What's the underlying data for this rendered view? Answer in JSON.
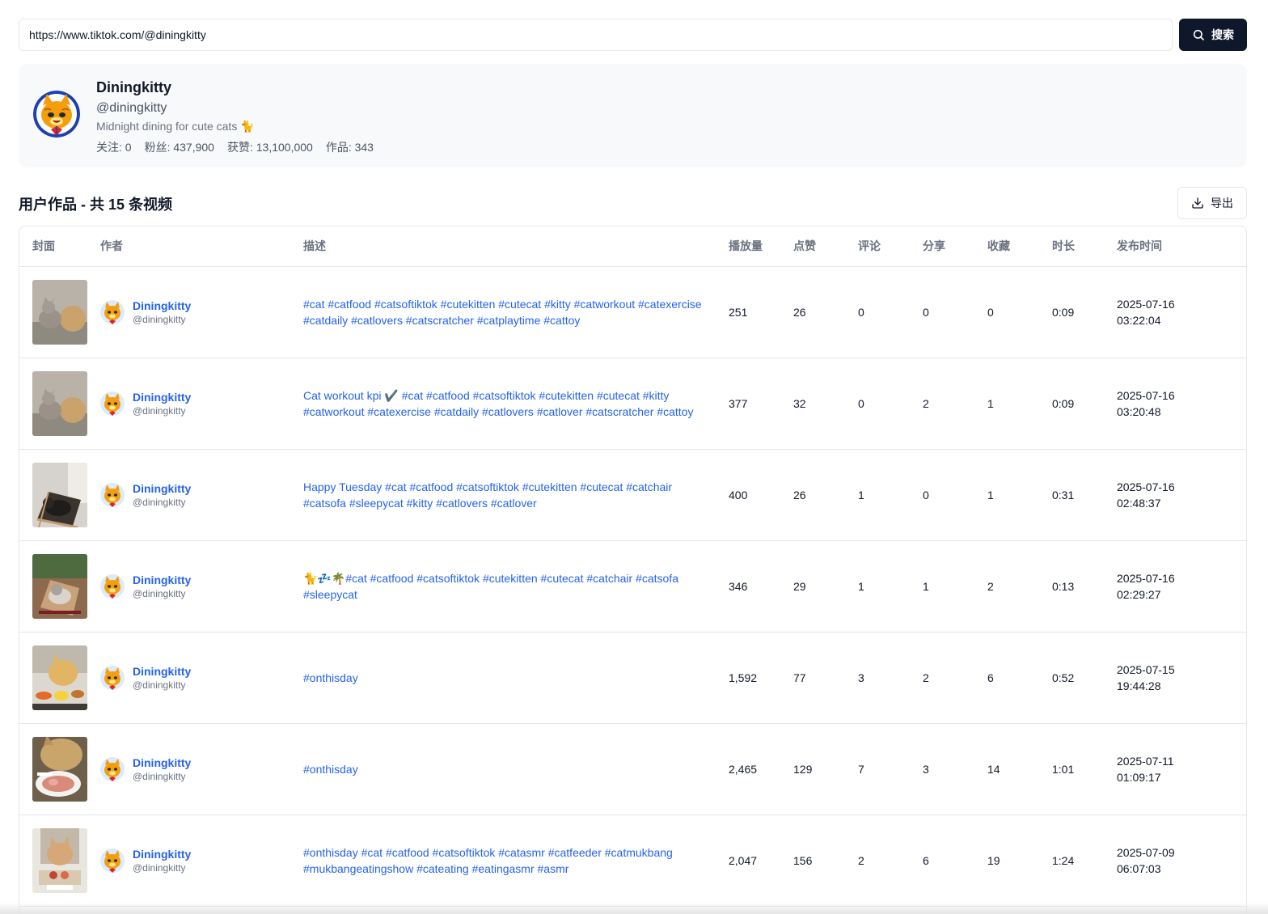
{
  "search": {
    "value": "https://www.tiktok.com/@diningkitty",
    "button_label": "搜索"
  },
  "profile": {
    "name": "Diningkitty",
    "handle": "@diningkitty",
    "bio": "Midnight dining for cute cats 🐈",
    "stats": [
      "关注: 0",
      "粉丝: 437,900",
      "获赞: 13,100,000",
      "作品: 343"
    ]
  },
  "section": {
    "title": "用户作品 - 共 15 条视频",
    "export_label": "导出"
  },
  "table": {
    "headers": {
      "cover": "封面",
      "author": "作者",
      "desc": "描述",
      "plays": "播放量",
      "likes": "点赞",
      "comments": "评论",
      "shares": "分享",
      "favorites": "收藏",
      "duration": "时长",
      "published": "发布时间"
    },
    "rows": [
      {
        "author_name": "Diningkitty",
        "author_handle": "@diningkitty",
        "desc": "#cat #catfood #catsoftiktok #cutekitten #cutecat #kitty #catworkout #catexercise #catdaily #catlovers #catscratcher #catplaytime #cattoy",
        "plays": "251",
        "likes": "26",
        "comments": "0",
        "shares": "0",
        "favorites": "0",
        "duration": "0:09",
        "date": "2025-07-16",
        "time": "03:22:04",
        "thumb": "cat-ball"
      },
      {
        "author_name": "Diningkitty",
        "author_handle": "@diningkitty",
        "desc": "Cat workout kpi ✔️ #cat #catfood #catsoftiktok #cutekitten #cutecat #kitty #catworkout #catexercise #catdaily #catlovers #catlover #catscratcher #cattoy",
        "plays": "377",
        "likes": "32",
        "comments": "0",
        "shares": "2",
        "favorites": "1",
        "duration": "0:09",
        "date": "2025-07-16",
        "time": "03:20:48",
        "thumb": "cat-ball"
      },
      {
        "author_name": "Diningkitty",
        "author_handle": "@diningkitty",
        "desc": "Happy Tuesday #cat #catfood #catsoftiktok #cutekitten #cutecat #catchair #catsofa #sleepycat #kitty #catlovers #catlover",
        "plays": "400",
        "likes": "26",
        "comments": "1",
        "shares": "0",
        "favorites": "1",
        "duration": "0:31",
        "date": "2025-07-16",
        "time": "02:48:37",
        "thumb": "cat-chair-dark"
      },
      {
        "author_name": "Diningkitty",
        "author_handle": "@diningkitty",
        "desc": "🐈💤🌴#cat #catfood #catsoftiktok #cutekitten #cutecat #catchair #catsofa #sleepycat",
        "plays": "346",
        "likes": "29",
        "comments": "1",
        "shares": "1",
        "favorites": "2",
        "duration": "0:13",
        "date": "2025-07-16",
        "time": "02:29:27",
        "thumb": "cat-chair-green"
      },
      {
        "author_name": "Diningkitty",
        "author_handle": "@diningkitty",
        "desc": "#onthisday",
        "plays": "1,592",
        "likes": "77",
        "comments": "3",
        "shares": "2",
        "favorites": "6",
        "duration": "0:52",
        "date": "2025-07-15",
        "time": "19:44:28",
        "thumb": "cat-food-orange"
      },
      {
        "author_name": "Diningkitty",
        "author_handle": "@diningkitty",
        "desc": "#onthisday",
        "plays": "2,465",
        "likes": "129",
        "comments": "7",
        "shares": "3",
        "favorites": "14",
        "duration": "1:01",
        "date": "2025-07-11",
        "time": "01:09:17",
        "thumb": "cat-plate"
      },
      {
        "author_name": "Diningkitty",
        "author_handle": "@diningkitty",
        "desc": "#onthisday #cat #catfood #catsoftiktok #catasmr #catfeeder #catmukbang #mukbangeatingshow #cateating #eatingasmr #asmr",
        "plays": "2,047",
        "likes": "156",
        "comments": "2",
        "shares": "6",
        "favorites": "19",
        "duration": "1:24",
        "date": "2025-07-09",
        "time": "06:07:03",
        "thumb": "cat-tray"
      }
    ]
  },
  "icons": {
    "search": "search-icon",
    "export": "download-icon",
    "avatar": "cat-face-avatar"
  },
  "colors": {
    "primary_button": "#0f172a",
    "link": "#2563eb",
    "card_bg": "#f8f9fa",
    "border": "#e5e7eb"
  }
}
